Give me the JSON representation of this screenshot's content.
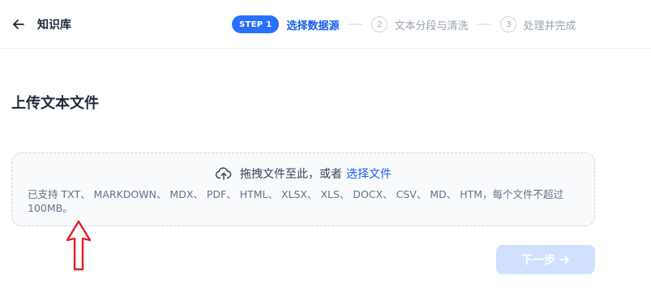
{
  "header": {
    "back_icon": "arrow-left-icon",
    "title": "知识库"
  },
  "stepper": {
    "active_badge": "STEP 1",
    "active_label": "选择数据源",
    "steps": [
      {
        "number": "2",
        "label": "文本分段与清洗"
      },
      {
        "number": "3",
        "label": "处理并完成"
      }
    ],
    "accent_color": "#2970ff"
  },
  "main": {
    "title": "上传文本文件",
    "dropzone": {
      "icon": "cloud-upload-icon",
      "text": "拖拽文件至此，或者",
      "link": "选择文件",
      "hint": "已支持 TXT、 MARKDOWN、 MDX、 PDF、 HTML、 XLSX、 XLS、 DOCX、 CSV、 MD、 HTM，每个文件不超过 100MB。"
    },
    "next_button": {
      "label": "下一步",
      "icon": "arrow-right-icon",
      "disabled": true
    }
  },
  "annotation": {
    "icon": "red-arrow-up-icon",
    "color": "#e0202a"
  }
}
